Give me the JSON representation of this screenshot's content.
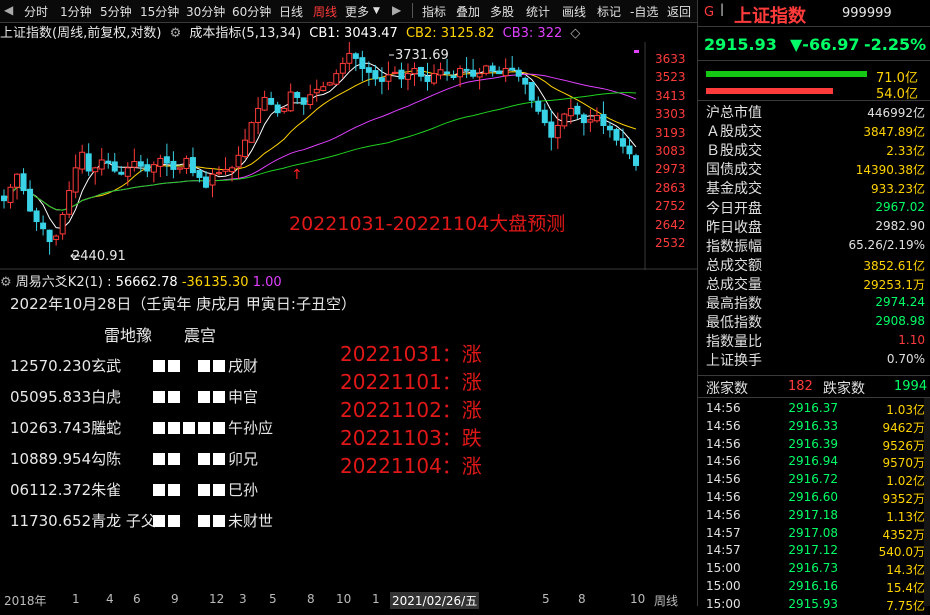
{
  "toolbar": {
    "periods": [
      "分时",
      "1分钟",
      "5分钟",
      "15分钟",
      "30分钟",
      "60分钟",
      "日线",
      "周线",
      "更多"
    ],
    "active": "周线",
    "tools": [
      "指标",
      "叠加",
      "多股",
      "统计",
      "画线",
      "标记",
      "-自选",
      "返回"
    ]
  },
  "chart_header": {
    "title": "上证指数(周线,前复权,对数)",
    "indicator": "成本指标(5,13,34)",
    "cb1": "CB1: 3043.47",
    "cb2": "CB2: 3125.82",
    "cb3": "CB3: 322"
  },
  "chart_data": {
    "type": "candlestick",
    "y_ticks": [
      "3633",
      "3523",
      "3413",
      "3303",
      "3193",
      "3083",
      "2973",
      "2863",
      "2752",
      "2642",
      "2532"
    ],
    "high_label": "3731.69",
    "low_label": "2440.91",
    "overlay_title": "20221031-20221104大盘预测",
    "x_ticks": [
      "2018年",
      "1",
      "4",
      "6",
      "9",
      "12",
      "3",
      "5",
      "8",
      "10",
      "1",
      "2021/02/26/五",
      "5",
      "8",
      "10",
      "周线"
    ],
    "closes": [
      2700,
      2780,
      2860,
      2760,
      2640,
      2580,
      2540,
      2470,
      2500,
      2620,
      2760,
      2900,
      3000,
      2880,
      2900,
      2950,
      2930,
      2880,
      2860,
      2900,
      2940,
      2910,
      2880,
      2920,
      2960,
      2930,
      2890,
      2900,
      2960,
      2870,
      2840,
      2780,
      2860,
      2870,
      2890,
      2900,
      2980,
      3080,
      3200,
      3300,
      3380,
      3330,
      3270,
      3300,
      3420,
      3380,
      3330,
      3400,
      3440,
      3460,
      3490,
      3560,
      3640,
      3720,
      3680,
      3600,
      3570,
      3520,
      3500,
      3550,
      3570,
      3520,
      3560,
      3600,
      3540,
      3500,
      3560,
      3590,
      3560,
      3530,
      3600,
      3590,
      3540,
      3560,
      3620,
      3580,
      3560,
      3600,
      3590,
      3540,
      3480,
      3360,
      3280,
      3200,
      3100,
      3180,
      3260,
      3300,
      3260,
      3200,
      3220,
      3250,
      3180,
      3150,
      3080,
      3040,
      2990,
      2915
    ]
  },
  "indicator_header": {
    "name": "周易六爻K2(1)",
    "v1": ": 56662.78",
    "v2": "-36135.30",
    "v3": "1.00"
  },
  "divination": {
    "date": "2022年10月28日（壬寅年 庚戌月 甲寅日:子丑空）",
    "gua": "雷地豫　　震宫",
    "lines": [
      {
        "num": "12570.230玄武",
        "pat": [
          1,
          1,
          0,
          1,
          1
        ],
        "rel": "戌财"
      },
      {
        "num": "05095.833白虎",
        "pat": [
          1,
          1,
          0,
          1,
          1
        ],
        "rel": "申官"
      },
      {
        "num": "10263.743螣蛇",
        "pat": [
          1,
          1,
          1,
          1,
          1
        ],
        "rel": "午孙应"
      },
      {
        "num": "10889.954勾陈",
        "pat": [
          1,
          1,
          0,
          1,
          1
        ],
        "rel": "卯兄"
      },
      {
        "num": "06112.372朱雀",
        "pat": [
          1,
          1,
          0,
          1,
          1
        ],
        "rel": "巳孙"
      },
      {
        "num": "11730.652青龙 子父",
        "pat": [
          1,
          1,
          0,
          1,
          1
        ],
        "rel": "未财世"
      }
    ]
  },
  "predictions": [
    "20221031：涨",
    "20221101：涨",
    "20221102：涨",
    "20221103：跌",
    "20221104：涨"
  ],
  "quote": {
    "badge": "G",
    "name": "上证指数",
    "code": "999999",
    "price": "2915.93",
    "change": "▼-66.97",
    "pct": "-2.25%",
    "bar1_value": "71.0亿",
    "bar2_value": "54.0亿",
    "bar1_fill": 0.7,
    "bar2_fill": 0.55
  },
  "stats": [
    {
      "k": "沪总市值",
      "v": "446992亿",
      "c": "#e0e0e0"
    },
    {
      "k": "Ａ股成交",
      "v": "3847.89亿",
      "c": "#ffd400"
    },
    {
      "k": "Ｂ股成交",
      "v": "2.33亿",
      "c": "#ffd400"
    },
    {
      "k": "国债成交",
      "v": "14390.38亿",
      "c": "#ffd400"
    },
    {
      "k": "基金成交",
      "v": "933.23亿",
      "c": "#ffd400"
    },
    {
      "k": "今日开盘",
      "v": "2967.02",
      "c": "#00ff66"
    },
    {
      "k": "昨日收盘",
      "v": "2982.90",
      "c": "#e0e0e0"
    },
    {
      "k": "指数振幅",
      "v": "65.26/2.19%",
      "c": "#e0e0e0"
    },
    {
      "k": "总成交额",
      "v": "3852.61亿",
      "c": "#ffd400"
    },
    {
      "k": "总成交量",
      "v": "29253.1万",
      "c": "#ffd400"
    },
    {
      "k": "最高指数",
      "v": "2974.24",
      "c": "#00ff66"
    },
    {
      "k": "最低指数",
      "v": "2908.98",
      "c": "#00ff66"
    },
    {
      "k": "指数量比",
      "v": "1.10",
      "c": "#ff3b3b"
    },
    {
      "k": "上证换手",
      "v": "0.70%",
      "c": "#e0e0e0"
    }
  ],
  "updown": {
    "up_label": "涨家数",
    "up": "182",
    "down_label": "跌家数",
    "down": "1994"
  },
  "ticks": [
    {
      "t": "14:56",
      "p": "2916.37",
      "q": "1.03亿"
    },
    {
      "t": "14:56",
      "p": "2916.33",
      "q": "9462万"
    },
    {
      "t": "14:56",
      "p": "2916.39",
      "q": "9526万"
    },
    {
      "t": "14:56",
      "p": "2916.94",
      "q": "9570万"
    },
    {
      "t": "14:56",
      "p": "2916.72",
      "q": "1.02亿"
    },
    {
      "t": "14:56",
      "p": "2916.60",
      "q": "9352万"
    },
    {
      "t": "14:56",
      "p": "2917.18",
      "q": "1.13亿"
    },
    {
      "t": "14:57",
      "p": "2917.08",
      "q": "4352万"
    },
    {
      "t": "14:57",
      "p": "2917.12",
      "q": "540.0万"
    },
    {
      "t": "15:00",
      "p": "2916.73",
      "q": "14.3亿"
    },
    {
      "t": "15:00",
      "p": "2916.16",
      "q": "15.4亿"
    },
    {
      "t": "15:00",
      "p": "2915.93",
      "q": "7.75亿"
    }
  ]
}
